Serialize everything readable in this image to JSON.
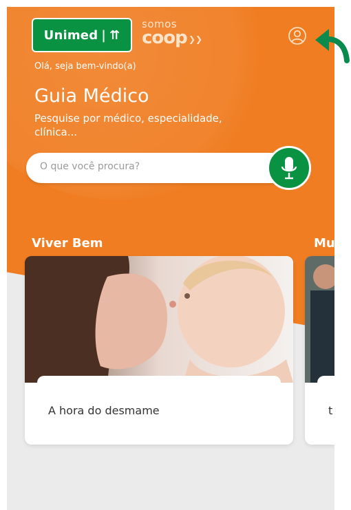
{
  "header": {
    "logo_text": "Unimed",
    "logo_mark": "⇈",
    "coop_line1": "somos",
    "coop_line2": "coop",
    "greeting": "Olá, seja bem-vindo(a)",
    "title": "Guia Médico",
    "subtitle": "Pesquise por médico, especialidade, clínica..."
  },
  "search": {
    "placeholder": "O que você procura?",
    "value": ""
  },
  "icons": {
    "profile": "user-circle-icon",
    "mic": "microphone-icon",
    "annotation": "curved-arrow-icon"
  },
  "sections": [
    {
      "title": "Viver Bem",
      "cards": [
        {
          "caption": "A hora do desmame"
        }
      ]
    },
    {
      "title": "Mu",
      "cards": [
        {
          "caption": "t"
        }
      ]
    }
  ],
  "colors": {
    "brand_orange": "#f07d22",
    "brand_green": "#0a9243",
    "background": "#ebebec"
  }
}
